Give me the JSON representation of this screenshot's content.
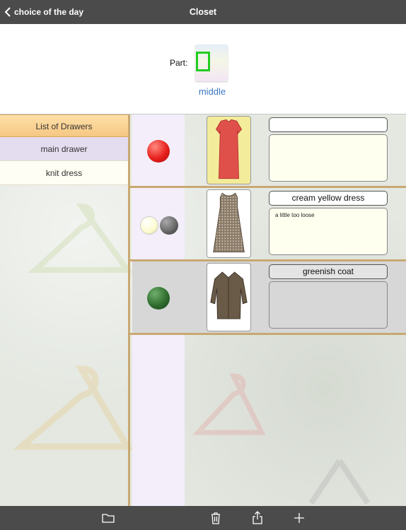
{
  "navbar": {
    "back_label": "choice of the day",
    "title": "Closet"
  },
  "part": {
    "label": "Part:",
    "value": "middle"
  },
  "sidebar": {
    "header": "List of Drawers",
    "items": [
      {
        "label": "main drawer",
        "selected": true
      },
      {
        "label": "knit dress",
        "selected": false
      }
    ]
  },
  "items": [
    {
      "name": "",
      "note": "",
      "colors": [
        "#e8201c"
      ],
      "image": "red-dress"
    },
    {
      "name": "cream yellow dress",
      "note": "a little too loose",
      "colors": [
        "#fdfbd0",
        "#6a6a6a"
      ],
      "image": "patterned-dress"
    },
    {
      "name": "greenish coat",
      "note": "",
      "colors": [
        "#2f6e2e"
      ],
      "image": "coat"
    }
  ],
  "toolbar": {
    "icons": [
      "folder-icon",
      "trash-icon",
      "share-icon",
      "plus-icon"
    ]
  }
}
